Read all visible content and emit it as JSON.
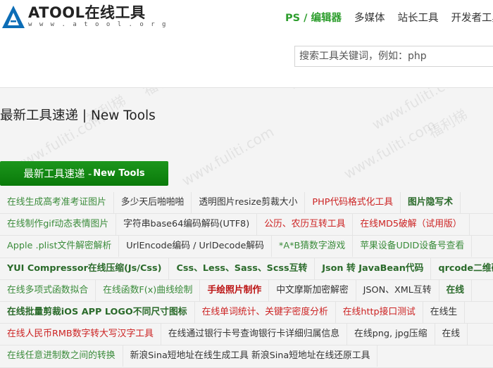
{
  "brand": {
    "name": "ATOOL在线工具",
    "url": "w w w . a t o o l . o r g"
  },
  "nav": [
    {
      "label": "PS / 编辑器",
      "active": true
    },
    {
      "label": "多媒体",
      "active": false
    },
    {
      "label": "站长工具",
      "active": false
    },
    {
      "label": "开发者工具",
      "active": false
    }
  ],
  "search": {
    "placeholder": "搜索工具关键词，例如：php"
  },
  "section_title": "最新工具速递 | New Tools",
  "new_tools_button": {
    "cn": "最新工具速递 - ",
    "en": "New Tools"
  },
  "watermark": {
    "text_cn": "福利梯",
    "text_url": "www.fuliti.com"
  },
  "tool_rows": [
    [
      {
        "label": "在线生成高考准考证图片",
        "style": "green"
      },
      {
        "label": "多少天后啪啪啪",
        "style": "dark"
      },
      {
        "label": "透明图片resize剪裁大小",
        "style": "dark"
      },
      {
        "label": "PHP代码格式化工具",
        "style": "red"
      },
      {
        "label": "图片隐写术",
        "style": "bold"
      }
    ],
    [
      {
        "label": "在线制作gif动态表情图片",
        "style": "green"
      },
      {
        "label": "字符串base64编码解码(UTF8)",
        "style": "dark"
      },
      {
        "label": "公历、农历互转工具",
        "style": "red"
      },
      {
        "label": "在线MD5破解（试用版）",
        "style": "red"
      }
    ],
    [
      {
        "label": "Apple .plist文件解密解析",
        "style": "green"
      },
      {
        "label": "UrlEncode编码 / UrlDecode解码",
        "style": "dark"
      },
      {
        "label": "*A*B猜数字游戏",
        "style": "green"
      },
      {
        "label": "苹果设备UDID设备号查看",
        "style": "green"
      }
    ],
    [
      {
        "label": "YUI Compressor在线压缩(Js/Css)",
        "style": "bold"
      },
      {
        "label": "Css、Less、Sass、Scss互转",
        "style": "bold"
      },
      {
        "label": "Json 转 JavaBean代码",
        "style": "bold"
      },
      {
        "label": "qrcode二维码",
        "style": "bold"
      }
    ],
    [
      {
        "label": "在线多项式函数拟合",
        "style": "green"
      },
      {
        "label": "在线函数F(x)曲线绘制",
        "style": "green"
      },
      {
        "label": "手绘照片制作",
        "style": "darkred"
      },
      {
        "label": "中文摩斯加密解密",
        "style": "dark"
      },
      {
        "label": "JSON、XML互转",
        "style": "dark"
      },
      {
        "label": "在线",
        "style": "bold"
      }
    ],
    [
      {
        "label": "在线批量剪裁iOS APP LOGO不同尺寸图标",
        "style": "bold"
      },
      {
        "label": "在线单词统计、关键字密度分析",
        "style": "red"
      },
      {
        "label": "在线http接口测试",
        "style": "red"
      },
      {
        "label": "在线生",
        "style": "dark"
      }
    ],
    [
      {
        "label": "在线人民币RMB数字转大写汉字工具",
        "style": "red"
      },
      {
        "label": "在线通过银行卡号查询银行卡详细归属信息",
        "style": "dark"
      },
      {
        "label": "在线png, jpg压缩",
        "style": "dark"
      },
      {
        "label": "在线",
        "style": "dark"
      }
    ],
    [
      {
        "label": "在线任意进制数之间的转换",
        "style": "green"
      },
      {
        "label": "新浪Sina短地址在线生成工具 新浪Sina短地址在线还原工具",
        "style": "dark"
      }
    ]
  ]
}
